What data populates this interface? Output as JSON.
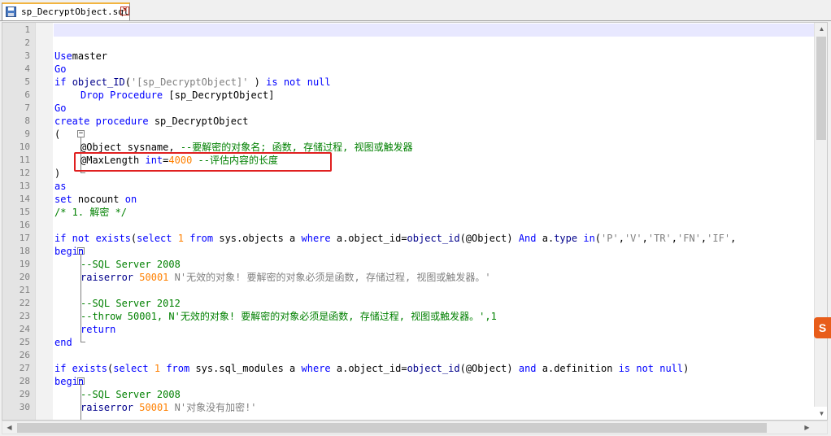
{
  "tab": {
    "title": "sp_DecryptObject.sql",
    "close_glyph": "×"
  },
  "editor": {
    "line_numbers": [
      "1",
      "2",
      "3",
      "4",
      "5",
      "6",
      "7",
      "8",
      "9",
      "10",
      "11",
      "12",
      "13",
      "14",
      "15",
      "16",
      "17",
      "18",
      "19",
      "20",
      "21",
      "22",
      "23",
      "24",
      "25",
      "26",
      "27",
      "28",
      "29",
      "30"
    ],
    "lines": [
      [],
      [],
      [
        [
          "kw",
          "Use"
        ],
        [
          "",
          "master"
        ]
      ],
      [
        [
          "kw",
          "Go"
        ]
      ],
      [
        [
          "kw",
          "if"
        ],
        [
          "",
          " "
        ],
        [
          "fn",
          "object_ID"
        ],
        [
          "",
          "("
        ],
        [
          "str",
          "'[sp_DecryptObject]'"
        ],
        [
          "",
          " ) "
        ],
        [
          "kw",
          "is not null"
        ]
      ],
      [
        [
          "",
          " "
        ],
        [
          "kw",
          "Drop Procedure"
        ],
        [
          "",
          " [sp_DecryptObject]"
        ]
      ],
      [
        [
          "kw",
          "Go"
        ]
      ],
      [
        [
          "kw",
          "create procedure"
        ],
        [
          "",
          " sp_DecryptObject"
        ]
      ],
      [
        [
          "",
          "("
        ]
      ],
      [
        [
          "",
          " @Object sysname, "
        ],
        [
          "cm",
          "--要解密的对象名; 函数, 存储过程, 视图或触发器"
        ]
      ],
      [
        [
          "",
          " @MaxLength "
        ],
        [
          "kw",
          "int"
        ],
        [
          "",
          "="
        ],
        [
          "num",
          "4000"
        ],
        [
          "",
          " "
        ],
        [
          "cm",
          "--评估内容的长度"
        ]
      ],
      [
        [
          "",
          ")"
        ]
      ],
      [
        [
          "kw",
          "as"
        ]
      ],
      [
        [
          "kw",
          "set"
        ],
        [
          "",
          " nocount "
        ],
        [
          "kw",
          "on"
        ]
      ],
      [
        [
          "cm",
          "/* 1. 解密 */"
        ]
      ],
      [],
      [
        [
          "kw",
          "if not exists"
        ],
        [
          "",
          "("
        ],
        [
          "kw",
          "select"
        ],
        [
          "",
          " "
        ],
        [
          "num",
          "1"
        ],
        [
          "",
          " "
        ],
        [
          "kw",
          "from"
        ],
        [
          "",
          " sys.objects a "
        ],
        [
          "kw",
          "where"
        ],
        [
          "",
          " a.object_id="
        ],
        [
          "fn",
          "object_id"
        ],
        [
          "",
          "(@Object) "
        ],
        [
          "kw",
          "And"
        ],
        [
          "",
          " a."
        ],
        [
          "fn",
          "type"
        ],
        [
          "",
          " "
        ],
        [
          "kw",
          "in"
        ],
        [
          "",
          "("
        ],
        [
          "str",
          "'P'"
        ],
        [
          "",
          ","
        ],
        [
          "str",
          "'V'"
        ],
        [
          "",
          ","
        ],
        [
          "str",
          "'TR'"
        ],
        [
          "",
          ","
        ],
        [
          "str",
          "'FN'"
        ],
        [
          "",
          ","
        ],
        [
          "str",
          "'IF'"
        ],
        [
          "",
          ","
        ]
      ],
      [
        [
          "kw",
          "begin"
        ]
      ],
      [
        [
          "",
          " "
        ],
        [
          "cm",
          "--SQL Server 2008"
        ]
      ],
      [
        [
          "",
          " "
        ],
        [
          "fn",
          "raiserror"
        ],
        [
          "",
          " "
        ],
        [
          "num",
          "50001"
        ],
        [
          "",
          " "
        ],
        [
          "str",
          "N'无效的对象! 要解密的对象必须是函数, 存储过程, 视图或触发器。'"
        ]
      ],
      [],
      [
        [
          "",
          " "
        ],
        [
          "cm",
          "--SQL Server 2012"
        ]
      ],
      [
        [
          "",
          " "
        ],
        [
          "cm",
          "--throw 50001, N'无效的对象! 要解密的对象必须是函数, 存储过程, 视图或触发器。',1"
        ]
      ],
      [
        [
          "",
          " "
        ],
        [
          "kw",
          "return"
        ]
      ],
      [
        [
          "kw",
          "end"
        ]
      ],
      [],
      [
        [
          "kw",
          "if exists"
        ],
        [
          "",
          "("
        ],
        [
          "kw",
          "select"
        ],
        [
          "",
          " "
        ],
        [
          "num",
          "1"
        ],
        [
          "",
          " "
        ],
        [
          "kw",
          "from"
        ],
        [
          "",
          " sys.sql_modules a "
        ],
        [
          "kw",
          "where"
        ],
        [
          "",
          " a.object_id="
        ],
        [
          "fn",
          "object_id"
        ],
        [
          "",
          "(@Object) "
        ],
        [
          "kw",
          "and"
        ],
        [
          "",
          " a.definition "
        ],
        [
          "kw",
          "is not null"
        ],
        [
          "",
          ")"
        ]
      ],
      [
        [
          "kw",
          "begin"
        ]
      ],
      [
        [
          "",
          " "
        ],
        [
          "cm",
          "--SQL Server 2008"
        ]
      ],
      [
        [
          "",
          " "
        ],
        [
          "fn",
          "raiserror"
        ],
        [
          "",
          " "
        ],
        [
          "num",
          "50001"
        ],
        [
          "",
          " "
        ],
        [
          "str",
          "N'对象没有加密!'"
        ]
      ]
    ]
  },
  "overlay": {
    "sogou_label": "S"
  }
}
